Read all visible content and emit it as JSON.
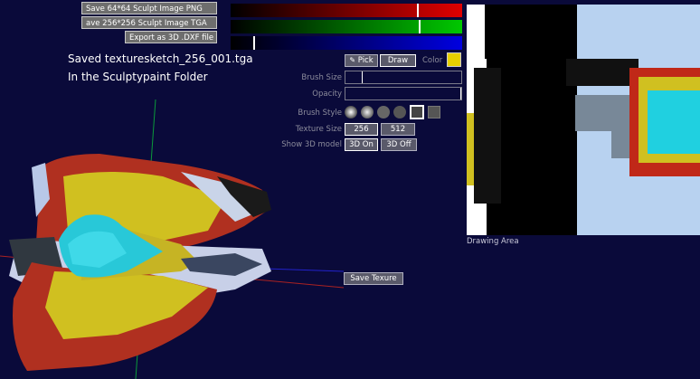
{
  "save_buttons": [
    {
      "label": "Save 64*64 Sculpt Image PNG"
    },
    {
      "label": "ave 256*256 Sculpt Image TGA"
    },
    {
      "label": "Export as 3D .DXF file"
    }
  ],
  "color_sliders": {
    "red": {
      "value": 0.81,
      "color": "#e00000"
    },
    "green": {
      "value": 0.82,
      "color": "#00c800"
    },
    "blue": {
      "value": 0.1,
      "color": "#0000e0"
    }
  },
  "status": {
    "line1": "Saved texturesketch_256_001.tga",
    "line2": "In the Sculptypaint Folder"
  },
  "tools": {
    "pick_label": "Pick",
    "draw_label": "Draw",
    "color_label": "Color",
    "current_color": "#e8d000"
  },
  "brush_size": {
    "label": "Brush Size",
    "value": 0.14
  },
  "opacity": {
    "label": "Opacity",
    "value": 1.0
  },
  "brush_style": {
    "label": "Brush Style"
  },
  "texture_size": {
    "label": "Texture Size",
    "options": [
      "256",
      "512"
    ],
    "selected": "256"
  },
  "show3d": {
    "label": "Show 3D model",
    "on_label": "3D On",
    "off_label": "3D Off",
    "selected": "3D On"
  },
  "drawing_area_label": "Drawing Area",
  "save_texture_label": "Save Texure"
}
